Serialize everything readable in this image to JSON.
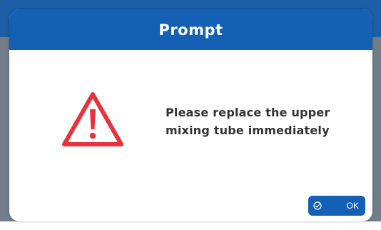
{
  "dialog": {
    "title": "Prompt",
    "message": "Please replace the upper mixing tube immediately",
    "icon": "warning-icon",
    "ok_button": {
      "label": "OK",
      "icon": "check-circle-icon"
    }
  },
  "colors": {
    "header": "#1360b5",
    "button": "#1360b5",
    "warning": "#e8333b",
    "text": "#333333"
  }
}
